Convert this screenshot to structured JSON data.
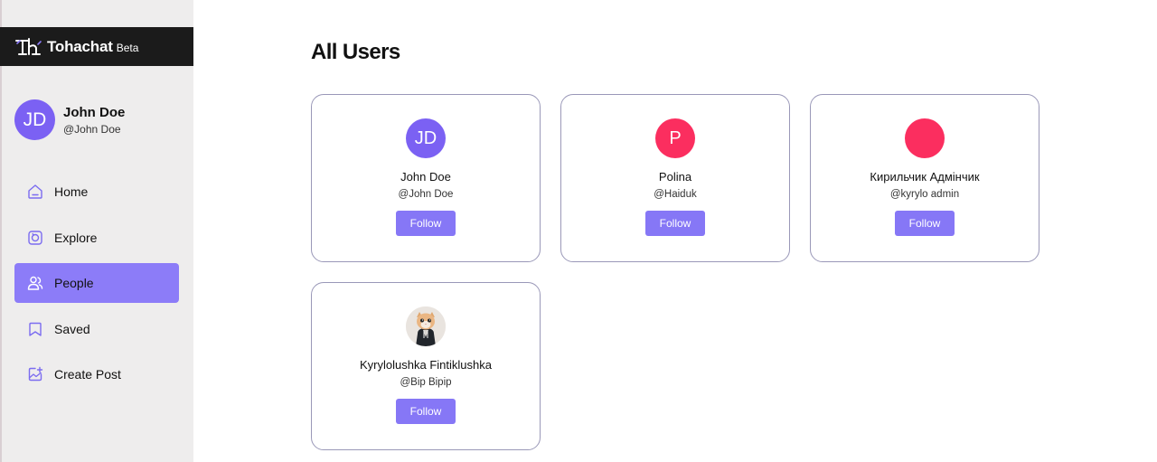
{
  "brand": {
    "name": "Tohachat",
    "tag": "Beta",
    "logo_icon": "tohachat-logo"
  },
  "profile": {
    "initials": "JD",
    "name": "John Doe",
    "handle": "@John Doe",
    "avatar_color": "#7b61f3"
  },
  "nav": {
    "items": [
      {
        "label": "Home",
        "icon": "home-icon",
        "active": false
      },
      {
        "label": "Explore",
        "icon": "explore-icon",
        "active": false
      },
      {
        "label": "People",
        "icon": "people-icon",
        "active": true
      },
      {
        "label": "Saved",
        "icon": "bookmark-icon",
        "active": false
      },
      {
        "label": "Create Post",
        "icon": "create-post-icon",
        "active": false
      }
    ]
  },
  "main": {
    "title": "All Users"
  },
  "users": [
    {
      "initials": "JD",
      "name": "John Doe",
      "handle": "@John Doe",
      "avatar_color": "#7b61f3",
      "follow_label": "Follow"
    },
    {
      "initials": "P",
      "name": "Polina",
      "handle": "@Haiduk",
      "avatar_color": "#fb2e5f",
      "follow_label": "Follow"
    },
    {
      "initials": "",
      "name": "Кирильчик Адмінчик",
      "handle": "@kyrylo admin",
      "avatar_color": "#fb2e5f",
      "follow_label": "Follow"
    },
    {
      "initials": "",
      "name": "Kyrylolushka Fintiklushka",
      "handle": "@Bip Bipip",
      "avatar_color": "#ece7e3",
      "avatar_image": "kitten-photo",
      "follow_label": "Follow"
    }
  ],
  "colors": {
    "accent": "#8677f6",
    "nav_active": "#8c7cf8",
    "sidebar_bg": "#eeeded",
    "brandbar_bg": "#1b1b1b",
    "card_border": "#9a98b8"
  }
}
